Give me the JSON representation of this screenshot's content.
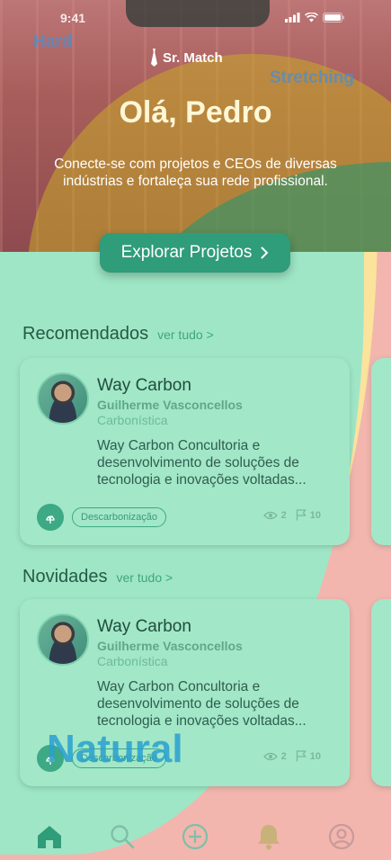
{
  "status_bar": {
    "time": "9:41"
  },
  "zone_labels": {
    "hard": "Hard",
    "stretching": "Stretching",
    "natural": "Natural"
  },
  "brand": {
    "name": "Sr. Match"
  },
  "hero": {
    "greeting": "Olá, Pedro",
    "intro": "Conecte-se com projetos e CEOs de diversas indústrias e fortaleça sua rede profissional.",
    "cta_label": "Explorar Projetos",
    "cta_icon": "chevron-right-icon"
  },
  "sections": [
    {
      "title": "Recomendados",
      "more": "ver tudo >",
      "card": {
        "company": "Way Carbon",
        "person": "Guilherme Vasconcellos",
        "role": "Carbonística",
        "description": "Way Carbon Concultoria e desenvolvimento de soluções de tecnologia e inovações voltadas...",
        "tag": "Descarbonização",
        "views": "2",
        "flags": "10"
      }
    },
    {
      "title": "Novidades",
      "more": "ver tudo >",
      "card": {
        "company": "Way Carbon",
        "person": "Guilherme Vasconcellos",
        "role": "Carbonística",
        "description": "Way Carbon Concultoria e desenvolvimento de soluções de tecnologia e inovações voltadas...",
        "tag": "Descarbonização",
        "views": "2",
        "flags": "10"
      }
    }
  ],
  "tab_bar": {
    "items": [
      "home-icon",
      "search-icon",
      "add-circle-icon",
      "bell-icon",
      "profile-icon"
    ],
    "active": "home-icon"
  },
  "colors": {
    "accent": "#2f9c7a",
    "zone_green": "#9fe6c6",
    "zone_yellow": "#fbe39c",
    "zone_red": "#f2b6ae"
  }
}
